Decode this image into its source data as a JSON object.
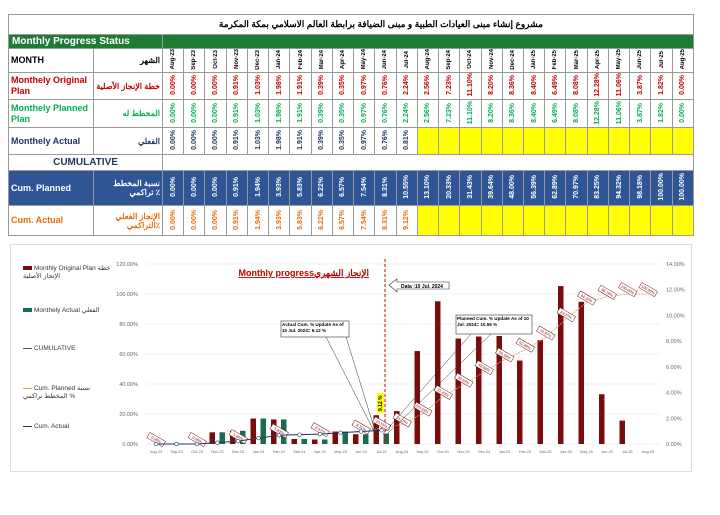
{
  "title": "مشروع إنشاء مبنى العيادات الطبية و مبنى الضيافة برابطة العالم الاسلامي بمكة المكرمة",
  "table": {
    "status_label": "Monthly  Progress Status",
    "month_label": "MONTH",
    "month_label_ar": "الشهر",
    "months": [
      "Aug-23",
      "Sep-23",
      "Oct-23",
      "Nov-23",
      "Dec-23",
      "Jan-24",
      "Feb-24",
      "Mar-24",
      "Apr-24",
      "May-24",
      "Jun-24",
      "Jul-24",
      "Aug-24",
      "Sep-24",
      "Oct-24",
      "Nov-24",
      "Dec-24",
      "Jan-25",
      "Feb-25",
      "Mar-25",
      "Apr-25",
      "May-25",
      "Jun-25",
      "Jul-25",
      "Aug-25"
    ],
    "rows": [
      {
        "label": "Monthely Original Plan",
        "label_ar": "خطة الإنجاز الأصلية",
        "color": "#c00000",
        "values": [
          "0.00%",
          "0.00%",
          "0.00%",
          "0.91%",
          "1.03%",
          "1.98%",
          "1.91%",
          "0.39%",
          "0.35%",
          "0.97%",
          "0.76%",
          "2.24%",
          "2.56%",
          "7.23%",
          "11.10%",
          "8.20%",
          "8.36%",
          "8.40%",
          "6.49%",
          "8.08%",
          "12.28%",
          "11.06%",
          "3.87%",
          "1.82%",
          "0.00%"
        ]
      },
      {
        "label": "Monthely Planned Plan",
        "label_ar": "المخطط له",
        "color": "#00b050",
        "values": [
          "0.00%",
          "0.00%",
          "0.00%",
          "0.91%",
          "1.03%",
          "1.98%",
          "1.91%",
          "0.39%",
          "0.35%",
          "0.97%",
          "0.76%",
          "2.24%",
          "2.56%",
          "7.23%",
          "11.10%",
          "8.20%",
          "8.36%",
          "8.40%",
          "6.49%",
          "8.08%",
          "12.28%",
          "11.06%",
          "3.87%",
          "1.82%",
          "0.00%"
        ]
      },
      {
        "label": "Monthely  Actual",
        "label_ar": "الفعلي",
        "color": "#1f3864",
        "values": [
          "0.00%",
          "0.00%",
          "0.00%",
          "0.91%",
          "1.03%",
          "1.98%",
          "1.91%",
          "0.39%",
          "0.35%",
          "0.97%",
          "0.76%",
          "0.81%",
          "",
          "",
          "",
          "",
          "",
          "",
          "",
          "",
          "",
          "",
          "",
          "",
          ""
        ]
      }
    ],
    "cumulative_label": "CUMULATIVE",
    "cum_rows": [
      {
        "label": "Cum.  Planned",
        "label_ar": "نسبة المخطط تراكمي ٪",
        "color": "#ffffff",
        "values": [
          "0.00%",
          "0.00%",
          "0.00%",
          "0.91%",
          "1.94%",
          "3.93%",
          "5.83%",
          "6.22%",
          "6.57%",
          "7.54%",
          "8.31%",
          "10.55%",
          "13.10%",
          "20.33%",
          "31.43%",
          "39.64%",
          "48.00%",
          "56.39%",
          "62.89%",
          "70.97%",
          "83.25%",
          "94.32%",
          "98.18%",
          "100.00%",
          "100.00%"
        ]
      },
      {
        "label": "Cum. Actual",
        "label_ar": "الإنجاز الفعلي التراكمي٪",
        "color": "#e46c0a",
        "values": [
          "0.00%",
          "0.00%",
          "0.00%",
          "0.91%",
          "1.94%",
          "3.93%",
          "5.83%",
          "6.22%",
          "6.57%",
          "7.54%",
          "8.31%",
          "9.12%",
          "",
          "",
          "",
          "",
          "",
          "",
          "",
          "",
          "",
          "",
          "",
          "",
          ""
        ]
      }
    ]
  },
  "chart": {
    "title": "Monthly progressالإنجاز الشهري",
    "legend": [
      "Monthly Original Plan خطة الإنجاز الأصلية",
      "Monthely  Actual الفعلي",
      "CUMULATIVE",
      "Cum.  Planned  نسبة المخطط تراكمي %",
      "Cum. Actual"
    ],
    "date_callout": "Data  :10 Jul. 2024",
    "actual_callout": "Actual Cum. % Update As of 10 Jul. 2024= 9.12 %",
    "planned_callout": "Planned Cum. % Update As of 10 Jul. 2024= 10.55 %",
    "marker_label": "9.12 %",
    "colors": {
      "original": "#7b0c0c",
      "actual": "#1a6b4f",
      "cum_planned": "#e8a060",
      "cum_actual": "#1f3864"
    }
  },
  "chart_data": {
    "type": "bar",
    "categories": [
      "Aug-23",
      "Sep-23",
      "Oct-23",
      "Nov-23",
      "Dec-23",
      "Jan-24",
      "Feb-24",
      "Mar-24",
      "Apr-24",
      "May-24",
      "Jun-24",
      "Jul-24",
      "Aug-24",
      "Sep-24",
      "Oct-24",
      "Nov-24",
      "Dec-24",
      "Jan-25",
      "Feb-25",
      "Mar-25",
      "Apr-25",
      "May-25",
      "Jun-25",
      "Jul-25",
      "Aug-25"
    ],
    "series": [
      {
        "name": "Monthly Original Plan",
        "axis": "right",
        "type": "bar",
        "values": [
          0,
          0,
          0,
          0.91,
          1.03,
          1.98,
          1.91,
          0.39,
          0.35,
          0.97,
          0.76,
          2.24,
          2.56,
          7.23,
          11.1,
          8.2,
          8.36,
          8.4,
          6.49,
          8.08,
          12.28,
          11.06,
          3.87,
          1.82,
          0
        ]
      },
      {
        "name": "Monthely  Actual",
        "axis": "right",
        "type": "bar",
        "values": [
          0,
          0,
          0,
          0.91,
          1.03,
          1.98,
          1.91,
          0.39,
          0.35,
          0.97,
          0.76,
          0.81
        ]
      },
      {
        "name": "Cum.  Planned",
        "axis": "left",
        "type": "line",
        "values": [
          0,
          0,
          0,
          0.91,
          1.94,
          3.93,
          5.83,
          6.22,
          6.57,
          7.54,
          8.31,
          10.55,
          13.1,
          20.33,
          31.43,
          39.64,
          48.0,
          56.39,
          62.89,
          70.97,
          83.25,
          94.32,
          98.18,
          100,
          100
        ]
      },
      {
        "name": "Cum. Actual",
        "axis": "left",
        "type": "line",
        "values": [
          0,
          0,
          0,
          0.91,
          1.94,
          3.93,
          5.83,
          6.22,
          6.57,
          7.54,
          8.31,
          9.12
        ]
      }
    ],
    "left_ticks": [
      "0.00%",
      "20.00%",
      "40.00%",
      "60.00%",
      "80.00%",
      "100.00%",
      "120.00%"
    ],
    "right_ticks": [
      "0.00%",
      "2.00%",
      "4.00%",
      "6.00%",
      "8.00%",
      "10.00%",
      "12.00%",
      "14.00%"
    ],
    "ylim_left": [
      0,
      120
    ],
    "ylim_right": [
      0,
      14
    ],
    "legend_position": "left",
    "grid": true
  }
}
